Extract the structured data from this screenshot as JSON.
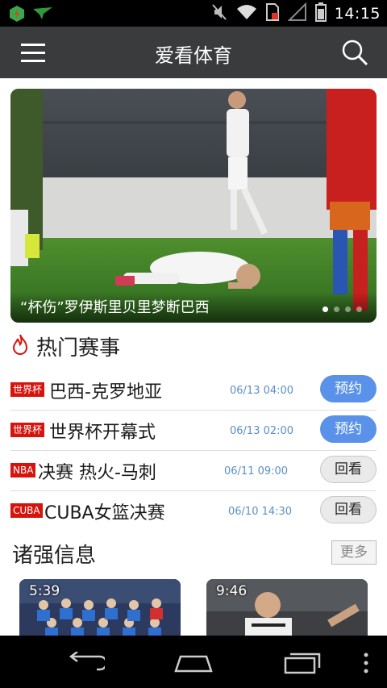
{
  "status_bar": {
    "time": "14:15"
  },
  "app_bar": {
    "title": "爱看体育"
  },
  "banner": {
    "caption": "“杯伤”罗伊斯里贝里梦断巴西",
    "slide_count": 4,
    "active_slide": 1
  },
  "hot_matches": {
    "title": "热门赛事",
    "items": [
      {
        "badge": "世界杯",
        "name": "巴西-克罗地亚",
        "time": "06/13 04:00",
        "action": "预约"
      },
      {
        "badge": "世界杯",
        "name": "世界杯开幕式",
        "time": "06/13 02:00",
        "action": "预约"
      },
      {
        "badge": "NBA",
        "name": "决赛 热火-马刺",
        "time": "06/11 09:00",
        "action": "回看"
      },
      {
        "badge": "CUBA",
        "name": "CUBA女篮决赛",
        "time": "06/10 14:30",
        "action": "回看"
      }
    ]
  },
  "team_info": {
    "title": "诸强信息",
    "more_label": "更多",
    "videos": [
      {
        "duration": "5:39"
      },
      {
        "duration": "9:46"
      }
    ]
  },
  "colors": {
    "accent": "#5b92e9",
    "badge": "#d5140d",
    "appbar": "#3a3b3d"
  }
}
